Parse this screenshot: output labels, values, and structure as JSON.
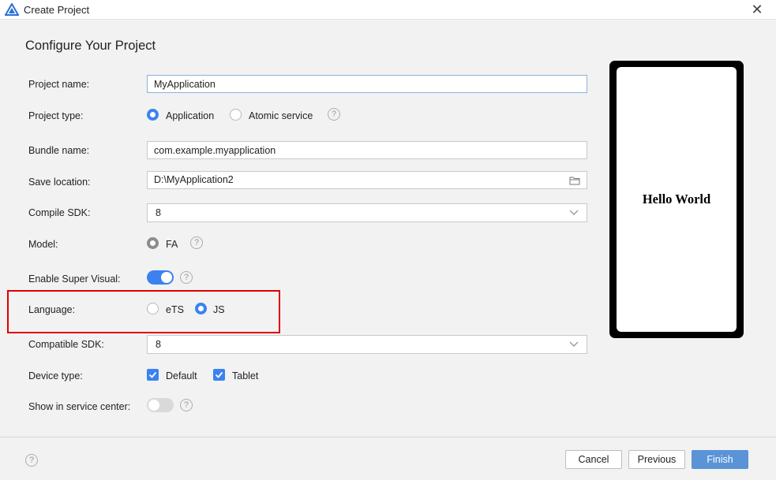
{
  "window": {
    "title": "Create Project",
    "close_label": "✕"
  },
  "page": {
    "title": "Configure Your Project"
  },
  "form": {
    "project_name": {
      "label": "Project name:",
      "value": "MyApplication"
    },
    "project_type": {
      "label": "Project type:",
      "options": [
        "Application",
        "Atomic service"
      ],
      "selected": "Application"
    },
    "bundle_name": {
      "label": "Bundle name:",
      "value": "com.example.myapplication"
    },
    "save_location": {
      "label": "Save location:",
      "value": "D:\\MyApplication2"
    },
    "compile_sdk": {
      "label": "Compile SDK:",
      "value": "8"
    },
    "model": {
      "label": "Model:",
      "options": [
        "FA"
      ],
      "selected": "FA"
    },
    "super_visual": {
      "label": "Enable Super Visual:",
      "enabled": true
    },
    "language": {
      "label": "Language:",
      "options": [
        "eTS",
        "JS"
      ],
      "selected": "JS"
    },
    "compatible_sdk": {
      "label": "Compatible SDK:",
      "value": "8"
    },
    "device_type": {
      "label": "Device type:",
      "options": [
        "Default",
        "Tablet"
      ],
      "checked": [
        "Default",
        "Tablet"
      ]
    },
    "service_center": {
      "label": "Show in service center:",
      "enabled": false
    }
  },
  "help_glyph": "?",
  "preview": {
    "text": "Hello World"
  },
  "footer": {
    "cancel": "Cancel",
    "previous": "Previous",
    "finish": "Finish"
  },
  "colors": {
    "accent": "#3b82f0",
    "primary_button": "#5a93d6",
    "highlight": "#e00000"
  }
}
